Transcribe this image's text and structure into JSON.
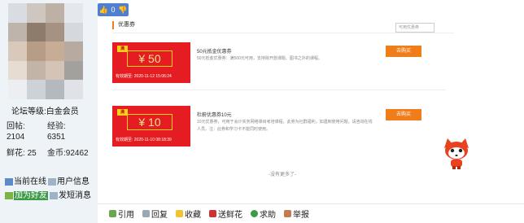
{
  "user": {
    "level_label": "论坛等级:",
    "level_value": "白金会员",
    "posts_label": "回帖:",
    "posts_value": "2104",
    "exp_label": "经验:",
    "exp_value": "6351",
    "flowers_label": "鲜花:",
    "flowers_value": "25",
    "coins_label": "金币:",
    "coins_value": "92462",
    "online_label": "当前在线",
    "info_label": "用户信息",
    "add_friend_label": "加为好友",
    "message_label": "发短消息"
  },
  "like": {
    "count": "0"
  },
  "coupons_section": {
    "title": "优惠券",
    "search_placeholder": "可用优惠券",
    "no_more": "-没有更多了-",
    "items": [
      {
        "badge": "满",
        "amount": "¥ 50",
        "valid": "有效期至: 2020-11-12 15:06:24",
        "name": "50元抵金优惠券",
        "desc": "50元抵金优惠券：满500元可用，支持除开放课题、图书之外的课程。",
        "buy": "去购买"
      },
      {
        "badge": "满",
        "amount": "¥ 10",
        "valid": "有效期至: 2020-11-10 08:18:39",
        "name": "杜蔚优惠券10元",
        "desc": "10元优惠券，可用于会计实务网络课目考培课程，此劵为社群福利，如遇到使用问题，请咨询在线人员。注：此券和学习卡不能同时使用。",
        "buy": "去购买"
      }
    ]
  },
  "actions": [
    {
      "label": "引用",
      "icon": "quote-icon",
      "color": "#6aa84f"
    },
    {
      "label": "回复",
      "icon": "reply-icon",
      "color": "#9aa7b5"
    },
    {
      "label": "收藏",
      "icon": "star-icon",
      "color": "#f1c232"
    },
    {
      "label": "送鲜花",
      "icon": "flower-icon",
      "color": "#cc3333"
    },
    {
      "label": "求助",
      "icon": "help-icon",
      "color": "#3d9a45"
    },
    {
      "label": "举报",
      "icon": "report-icon",
      "color": "#c27c4e"
    }
  ]
}
